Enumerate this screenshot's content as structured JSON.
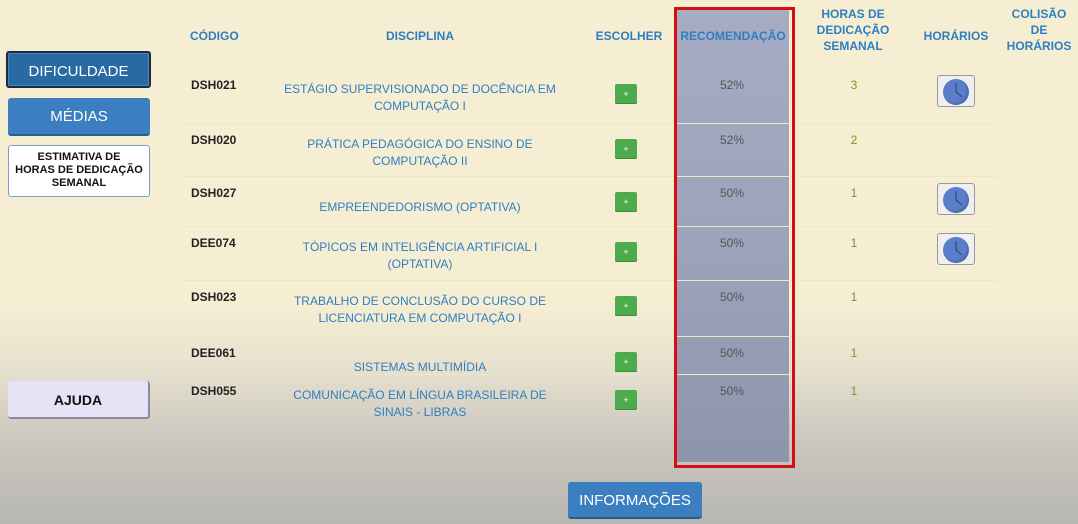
{
  "sidebar": {
    "dificuldade": "DIFICULDADE",
    "medias": "MÉDIAS",
    "estimativa_line1": "ESTIMATIVA DE",
    "estimativa_line2": "HORAS DE DEDICAÇÃO",
    "estimativa_line3": "SEMANAL",
    "ajuda": "AJUDA"
  },
  "table": {
    "headers": {
      "codigo": "CÓDIGO",
      "disciplina": "DISCIPLINA",
      "escolher": "ESCOLHER",
      "recomendacao": "RECOMENDAÇÃO",
      "horas_1": "HORAS DE",
      "horas_2": "DEDICAÇÃO",
      "horas_3": "SEMANAL",
      "horarios": "HORÁRIOS",
      "colisao_1": "COLISÃO",
      "colisao_2": "DE",
      "colisao_3": "HORÁRIOS"
    },
    "choose_label": "+",
    "rows": [
      {
        "code": "DSH021",
        "disc1": "ESTÁGIO SUPERVISIONADO DE DOCÊNCIA EM",
        "disc2": "COMPUTAÇÃO I",
        "rec": "52%",
        "hours": "3",
        "has_schedule": true
      },
      {
        "code": "DSH020",
        "disc1": "PRÁTICA PEDAGÓGICA DO ENSINO DE",
        "disc2": "COMPUTAÇÃO II",
        "rec": "52%",
        "hours": "2",
        "has_schedule": false
      },
      {
        "code": "DSH027",
        "disc1": "EMPREENDEDORISMO (OPTATIVA)",
        "disc2": "",
        "rec": "50%",
        "hours": "1",
        "has_schedule": true
      },
      {
        "code": "DEE074",
        "disc1": "TÓPICOS EM INTELIGÊNCIA ARTIFICIAL I",
        "disc2": "(OPTATIVA)",
        "rec": "50%",
        "hours": "1",
        "has_schedule": true
      },
      {
        "code": "DSH023",
        "disc1": "TRABALHO DE CONCLUSÃO DO CURSO DE",
        "disc2": "LICENCIATURA EM COMPUTAÇÃO I",
        "rec": "50%",
        "hours": "1",
        "has_schedule": false
      },
      {
        "code": "DEE061",
        "disc1": "SISTEMAS MULTIMÍDIA",
        "disc2": "",
        "rec": "50%",
        "hours": "1",
        "has_schedule": false
      },
      {
        "code": "DSH055",
        "disc1": "COMUNICAÇÃO EM LÍNGUA BRASILEIRA DE",
        "disc2": "SINAIS - LIBRAS",
        "rec": "50%",
        "hours": "1",
        "has_schedule": false
      }
    ]
  },
  "footer": {
    "informacoes": "INFORMAÇÕES"
  },
  "colors": {
    "accent_blue": "#2f7ec2",
    "choose_green": "#4eab4c",
    "highlight_red": "#d40f14",
    "hours_green": "#6b9a2a"
  },
  "icons": {
    "schedule": "clock-icon",
    "choose": "plus-icon"
  }
}
